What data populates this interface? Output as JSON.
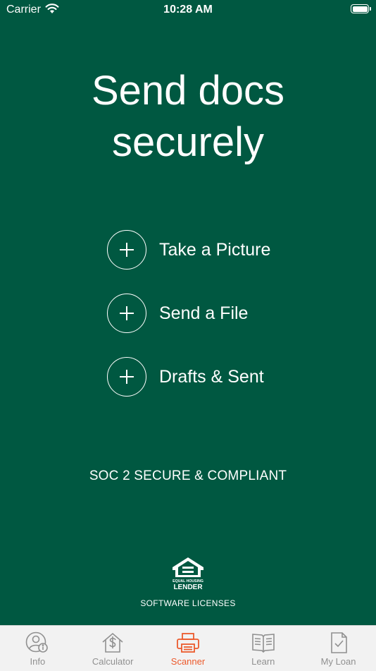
{
  "status_bar": {
    "carrier": "Carrier",
    "time": "10:28 AM"
  },
  "hero": {
    "line1": "Send docs",
    "line2": "securely"
  },
  "actions": [
    {
      "label": "Take a Picture"
    },
    {
      "label": "Send a File"
    },
    {
      "label": "Drafts & Sent"
    }
  ],
  "compliance": "SOC 2 SECURE & COMPLIANT",
  "logo": {
    "top_text": "EQUAL HOUSING",
    "bottom_text": "LENDER"
  },
  "licenses_link": "SOFTWARE LICENSES",
  "tabs": [
    {
      "label": "Info",
      "icon": "person-info-icon"
    },
    {
      "label": "Calculator",
      "icon": "house-dollar-icon"
    },
    {
      "label": "Scanner",
      "icon": "printer-icon",
      "active": true
    },
    {
      "label": "Learn",
      "icon": "book-icon"
    },
    {
      "label": "My Loan",
      "icon": "document-check-icon"
    }
  ],
  "colors": {
    "background": "#005841",
    "active_tab": "#ec5a2c",
    "inactive_tab": "#909090",
    "tab_bar": "#f2f2f2"
  }
}
